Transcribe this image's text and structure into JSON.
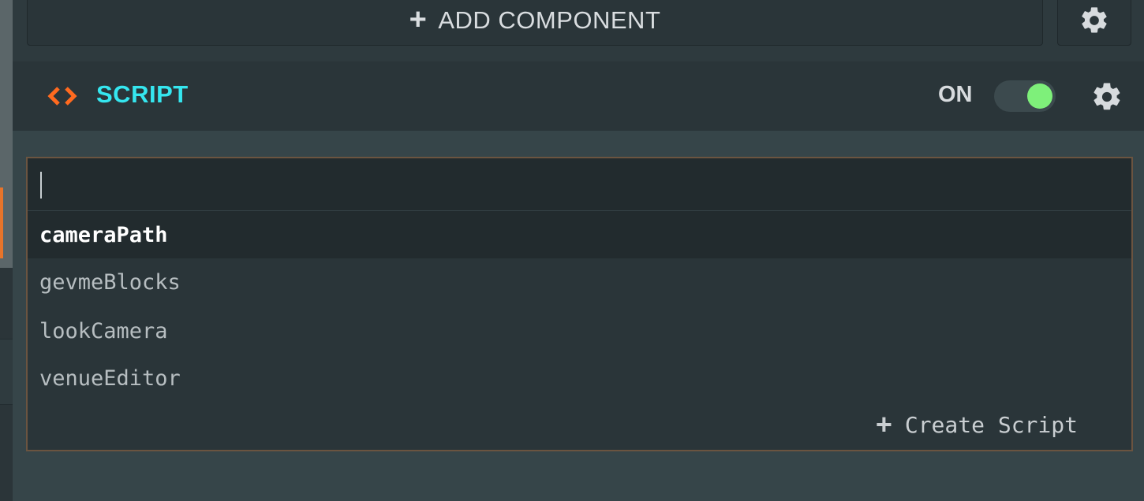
{
  "toolbar": {
    "add_component_label": "ADD COMPONENT",
    "plus_glyph": "+",
    "settings_icon": "gear-icon"
  },
  "component": {
    "icon": "code-brackets-icon",
    "title": "SCRIPT",
    "state_label": "ON",
    "enabled": true,
    "settings_icon": "gear-icon"
  },
  "script_picker": {
    "search_value": "",
    "search_placeholder": "",
    "options": [
      {
        "label": "cameraPath",
        "selected": true
      },
      {
        "label": "gevmeBlocks",
        "selected": false
      },
      {
        "label": "lookCamera",
        "selected": false
      },
      {
        "label": "venueEditor",
        "selected": false
      }
    ],
    "create_label": "Create Script",
    "create_glyph": "+"
  },
  "colors": {
    "accent_title": "#35e6ef",
    "icon_orange": "#ff6a1f",
    "toggle_on": "#7ef07a",
    "dropdown_border": "#6b5440"
  }
}
